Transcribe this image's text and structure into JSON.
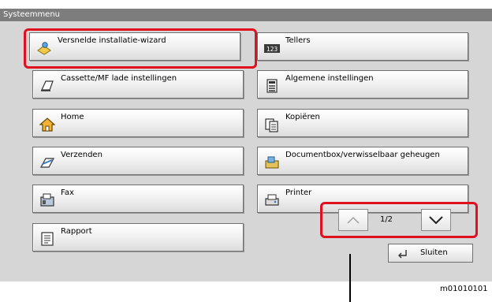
{
  "title": "Systeemmenu",
  "buttons": [
    {
      "id": "quick-setup-wizard",
      "label": "Versnelde installatie-wizard",
      "icon": "wizard-icon"
    },
    {
      "id": "counters",
      "label": "Tellers",
      "icon": "counter-123-icon"
    },
    {
      "id": "cassette-mp-tray-settings",
      "label": "Cassette/MF lade instellingen",
      "icon": "paper-tray-icon"
    },
    {
      "id": "common-settings",
      "label": "Algemene instellingen",
      "icon": "settings-document-icon"
    },
    {
      "id": "home",
      "label": "Home",
      "icon": "home-icon"
    },
    {
      "id": "copy",
      "label": "Kopiëren",
      "icon": "copy-icon"
    },
    {
      "id": "send",
      "label": "Verzenden",
      "icon": "send-icon"
    },
    {
      "id": "document-box",
      "label": "Documentbox/verwisselbaar geheugen",
      "icon": "document-box-icon"
    },
    {
      "id": "fax",
      "label": "Fax",
      "icon": "fax-icon"
    },
    {
      "id": "printer",
      "label": "Printer",
      "icon": "printer-icon"
    },
    {
      "id": "report",
      "label": "Rapport",
      "icon": "report-icon"
    }
  ],
  "pagination": {
    "current": "1/2"
  },
  "close_label": "Sluiten",
  "figure_code": "m01010101",
  "colors": {
    "highlight": "#e0101f",
    "title_bar": "#7d7d7d",
    "panel": "#d6d6d6"
  }
}
